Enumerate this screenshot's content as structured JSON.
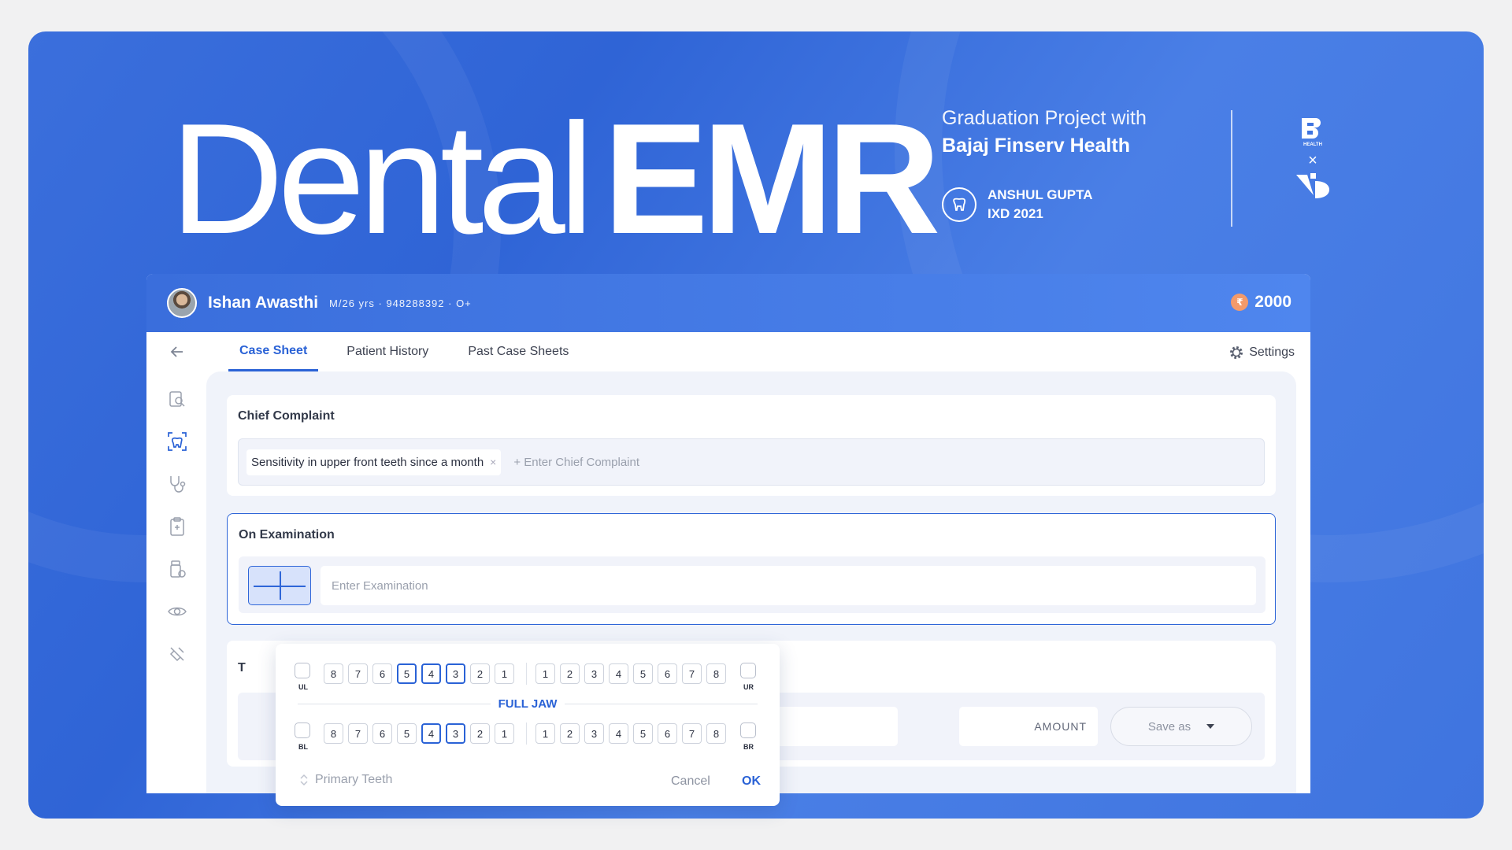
{
  "hero": {
    "title_regular": "Dental",
    "title_bold": "EMR",
    "grad_line1": "Graduation Project with",
    "grad_line2": "Bajaj Finserv Health",
    "author_name": "ANSHUL GUPTA",
    "author_batch": "IXD 2021",
    "logo_top_text": "HEALTH",
    "logo_separator": "×"
  },
  "header": {
    "patient_name": "Ishan Awasthi",
    "patient_meta": "M/26 yrs · 948288392 · O+",
    "coin_symbol": "₹",
    "coins": "2000"
  },
  "tabs": [
    {
      "label": "Case Sheet",
      "active": true
    },
    {
      "label": "Patient History",
      "active": false
    },
    {
      "label": "Past Case Sheets",
      "active": false
    }
  ],
  "settings_label": "Settings",
  "chief_complaint": {
    "title": "Chief Complaint",
    "chip": "Sensitivity in upper front teeth since a month",
    "chip_remove": "×",
    "add_placeholder": "+ Enter Chief Complaint"
  },
  "on_examination": {
    "title": "On Examination",
    "placeholder": "Enter Examination"
  },
  "treatment": {
    "title_initial": "T",
    "amount_label": "AMOUNT",
    "save_label": "Save as"
  },
  "tooth_picker": {
    "left_numbers": [
      "8",
      "7",
      "6",
      "5",
      "4",
      "3",
      "2",
      "1"
    ],
    "right_numbers": [
      "1",
      "2",
      "3",
      "4",
      "5",
      "6",
      "7",
      "8"
    ],
    "upper_left_selected": [
      "5",
      "4",
      "3"
    ],
    "lower_left_selected": [
      "4",
      "3"
    ],
    "ul": "UL",
    "ur": "UR",
    "bl": "BL",
    "br": "BR",
    "full_jaw": "FULL JAW",
    "primary": "Primary Teeth",
    "cancel": "Cancel",
    "ok": "OK"
  },
  "colors": {
    "accent": "#2a62d6",
    "header_gradient_start": "#3a6edc",
    "coin": "#f39a6a"
  }
}
